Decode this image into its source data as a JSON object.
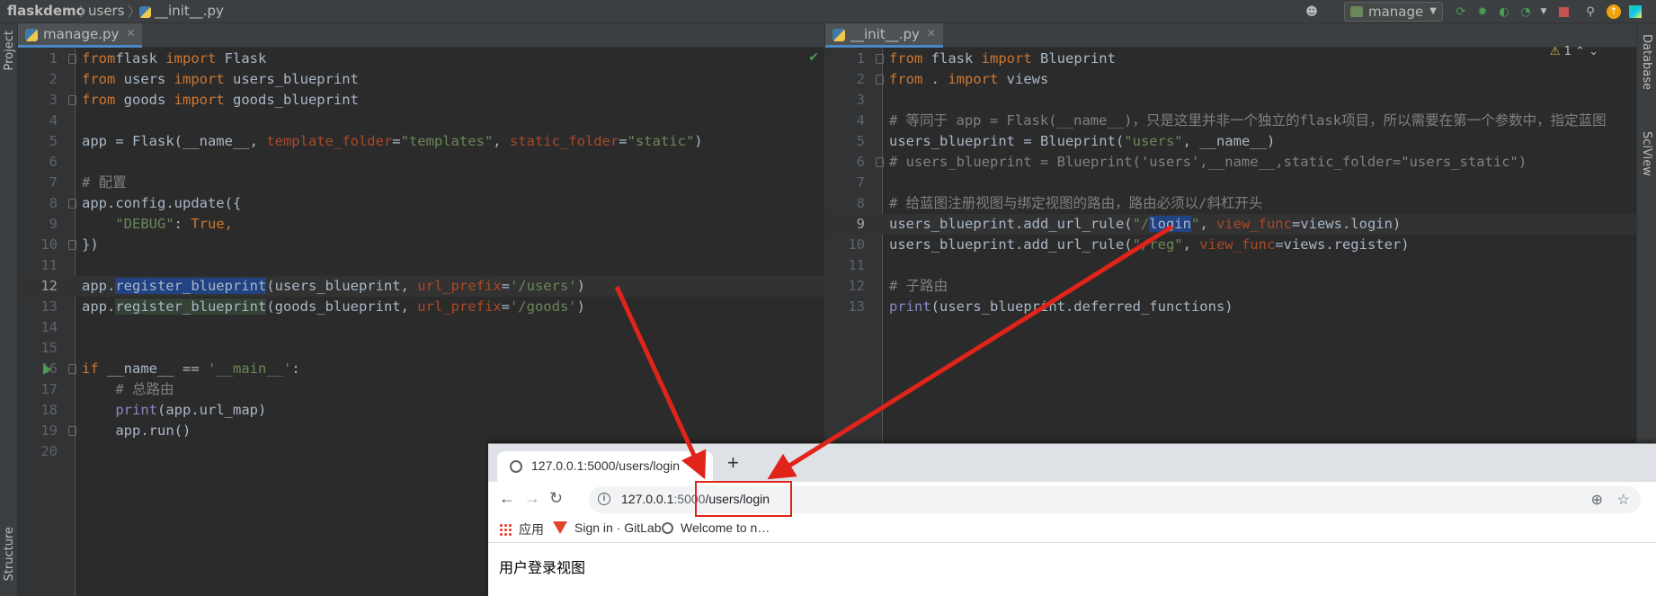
{
  "breadcrumb": {
    "project": "flaskdemo",
    "folder": "users",
    "file": "__init__.py"
  },
  "toolbar": {
    "run_config": "manage"
  },
  "tool_windows": {
    "left_top": "Project",
    "left_bottom": "Structure",
    "right_top": "Database",
    "right_second": "SciView"
  },
  "left_editor": {
    "tab": "manage.py",
    "lines": [
      {
        "n": "1",
        "t": [
          [
            "kw",
            "from"
          ],
          [
            "",
            "flask "
          ],
          [
            "kw",
            "import"
          ],
          [
            "",
            " Flask"
          ]
        ]
      },
      {
        "n": "2",
        "t": [
          [
            "kw",
            "from"
          ],
          [
            "",
            " users "
          ],
          [
            "kw",
            "import"
          ],
          [
            "",
            " users_blueprint"
          ]
        ]
      },
      {
        "n": "3",
        "t": [
          [
            "kw",
            "from"
          ],
          [
            "",
            " goods "
          ],
          [
            "kw",
            "import"
          ],
          [
            "",
            " goods_blueprint"
          ]
        ]
      },
      {
        "n": "4",
        "t": []
      },
      {
        "n": "5",
        "t": [
          [
            "",
            "app = Flask(__name__, "
          ],
          [
            "prm",
            "template_folder"
          ],
          [
            "",
            "="
          ],
          [
            "str",
            "\"templates\""
          ],
          [
            "",
            ", "
          ],
          [
            "prm",
            "static_folder"
          ],
          [
            "",
            "="
          ],
          [
            "str",
            "\"static\""
          ],
          [
            "",
            ")"
          ]
        ]
      },
      {
        "n": "6",
        "t": []
      },
      {
        "n": "7",
        "t": [
          [
            "cm",
            "# 配置"
          ]
        ]
      },
      {
        "n": "8",
        "t": [
          [
            "",
            "app.config.update({"
          ]
        ]
      },
      {
        "n": "9",
        "t": [
          [
            "str",
            "    \"DEBUG\""
          ],
          [
            "",
            ": "
          ],
          [
            "kw",
            "True,"
          ]
        ]
      },
      {
        "n": "10",
        "t": [
          [
            "",
            "})"
          ]
        ]
      },
      {
        "n": "11",
        "t": []
      },
      {
        "n": "12",
        "t": [
          [
            "",
            "app."
          ],
          [
            "hl",
            "register_blueprint"
          ],
          [
            "",
            "(users_blueprint, "
          ],
          [
            "prm",
            "url_prefix"
          ],
          [
            "",
            "="
          ],
          [
            "str",
            "'/users'"
          ],
          [
            "",
            ")"
          ]
        ]
      },
      {
        "n": "13",
        "t": [
          [
            "",
            "app."
          ],
          [
            "hl2",
            "register_blueprint"
          ],
          [
            "",
            "(goods_blueprint, "
          ],
          [
            "prm",
            "url_prefix"
          ],
          [
            "",
            "="
          ],
          [
            "str",
            "'/goods'"
          ],
          [
            "",
            ")"
          ]
        ]
      },
      {
        "n": "14",
        "t": []
      },
      {
        "n": "15",
        "t": []
      },
      {
        "n": "16",
        "t": [
          [
            "kw",
            "if"
          ],
          [
            "",
            " __name__ == "
          ],
          [
            "str",
            "'__main__'"
          ],
          [
            "",
            ":"
          ]
        ]
      },
      {
        "n": "17",
        "t": [
          [
            "cm",
            "    # 总路由"
          ]
        ]
      },
      {
        "n": "18",
        "t": [
          [
            "bi",
            "    print"
          ],
          [
            "",
            "(app.url_map)"
          ]
        ]
      },
      {
        "n": "19",
        "t": [
          [
            "",
            "    app.run()"
          ]
        ]
      },
      {
        "n": "20",
        "t": []
      }
    ]
  },
  "right_editor": {
    "tab": "__init__.py",
    "warning_count": "1",
    "lines": [
      {
        "n": "1",
        "t": [
          [
            "kw",
            "from"
          ],
          [
            "",
            " flask "
          ],
          [
            "kw",
            "import"
          ],
          [
            "",
            " Blueprint"
          ]
        ]
      },
      {
        "n": "2",
        "t": [
          [
            "kw",
            "from"
          ],
          [
            "",
            " . "
          ],
          [
            "kw",
            "import"
          ],
          [
            "",
            " views"
          ]
        ]
      },
      {
        "n": "3",
        "t": []
      },
      {
        "n": "4",
        "t": [
          [
            "cm",
            "# 等同于 app = Flask(__name__)，只是这里并非一个独立的flask项目，所以需要在第一个参数中，指定蓝图"
          ]
        ]
      },
      {
        "n": "5",
        "t": [
          [
            "",
            "users_blueprint = Blueprint("
          ],
          [
            "str",
            "\"users\""
          ],
          [
            "",
            ", __name__)"
          ]
        ]
      },
      {
        "n": "6",
        "t": [
          [
            "cm",
            "# users_blueprint = Blueprint('users',__name__,static_folder=\"users_static\")"
          ]
        ]
      },
      {
        "n": "7",
        "t": []
      },
      {
        "n": "8",
        "t": [
          [
            "cm",
            "# 给蓝图注册视图与绑定视图的路由，路由必须以/斜杠开头"
          ]
        ]
      },
      {
        "n": "9",
        "t": [
          [
            "",
            "users_blueprint.add_url_rule("
          ],
          [
            "str",
            "\"/"
          ],
          [
            "hl",
            "login"
          ],
          [
            "str",
            "\""
          ],
          [
            "",
            ", "
          ],
          [
            "prm",
            "view_func"
          ],
          [
            "",
            "=views.login)"
          ]
        ]
      },
      {
        "n": "10",
        "t": [
          [
            "",
            "users_blueprint.add_url_rule("
          ],
          [
            "str",
            "\"/reg\""
          ],
          [
            "",
            ", "
          ],
          [
            "prm",
            "view_func"
          ],
          [
            "",
            "=views.register)"
          ]
        ]
      },
      {
        "n": "11",
        "t": []
      },
      {
        "n": "12",
        "t": [
          [
            "cm",
            "# 子路由"
          ]
        ]
      },
      {
        "n": "13",
        "t": [
          [
            "bi",
            "print"
          ],
          [
            "",
            "(users_blueprint.deferred_functions)"
          ]
        ]
      }
    ]
  },
  "browser": {
    "tab_title": "127.0.0.1:5000/users/login",
    "url_host": "127.0.0.1",
    "url_port": ":5000",
    "url_path": "/users/login",
    "bookmarks": [
      "应用",
      "Sign in · GitLab",
      "Welcome to n…"
    ],
    "page_heading": "用户登录视图"
  },
  "colors": {
    "arrow": "#e0241a",
    "keyword": "#cc7832",
    "string": "#6a8759"
  }
}
